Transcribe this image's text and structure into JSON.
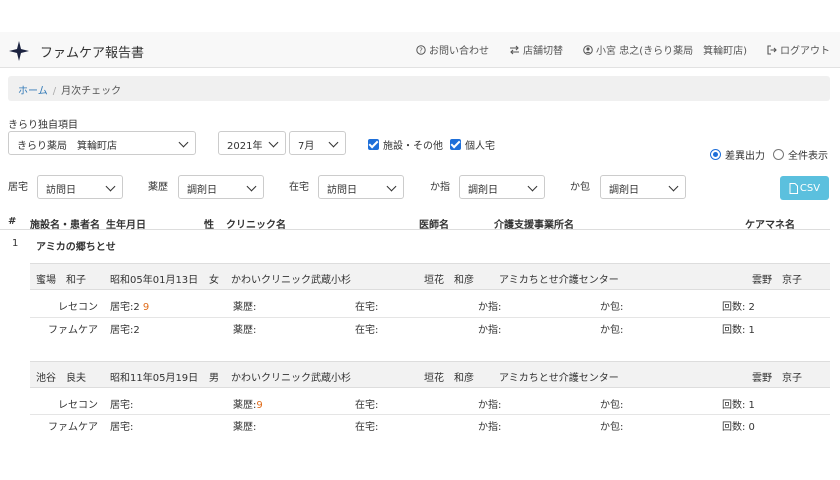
{
  "app": {
    "title": "ファムケア報告書"
  },
  "nav": {
    "contact": "お問い合わせ",
    "switch_store": "店舗切替",
    "user": "小宮 忠之(きらり薬局　箕輪町店)",
    "logout": "ログアウト"
  },
  "breadcrumb": {
    "home": "ホーム",
    "separator": "/",
    "current": "月次チェック"
  },
  "filters": {
    "store_label": "きらり独自項目",
    "store_value": "きらり薬局　箕輪町店",
    "year_value": "2021年",
    "month_value": "7月",
    "check_facility": "施設・その他",
    "check_individual": "個人宅",
    "radio_diff": "差異出力",
    "radio_all": "全件表示",
    "home_label": "居宅",
    "home_value": "訪問日",
    "drug_label": "薬歴",
    "drug_value": "調剤日",
    "zaitaku_label": "在宅",
    "zaitaku_value": "訪問日",
    "kashi_label": "か指",
    "kashi_value": "調剤日",
    "kahou_label": "か包",
    "kahou_value": "調剤日",
    "csv_button": "CSV"
  },
  "table": {
    "headers": {
      "num": "#",
      "facility": "施設名・患者名",
      "birth": "生年月日",
      "sex": "性",
      "clinic": "クリニック名",
      "doctor": "医師名",
      "care": "介護支援事業所名",
      "manager": "ケアマネ名"
    },
    "group": {
      "num": "1",
      "name": "アミカの郷ちとせ"
    },
    "patients": [
      {
        "name": "蜜場　和子",
        "birth": "昭和05年01月13日",
        "sex": "女",
        "clinic": "かわいクリニック武蔵小杉",
        "doctor": "垣花　和彦",
        "care": "アミカちとせ介護センター",
        "manager": "雲野　京子",
        "rows": [
          {
            "source": "レセコン",
            "home": "居宅:2",
            "home_diff": "9",
            "drug": "薬歴:",
            "drug_diff": "",
            "zaitaku": "在宅:",
            "kashi": "か指:",
            "kahou": "か包:",
            "count": "回数: 2"
          },
          {
            "source": "ファムケア",
            "home": "居宅:2",
            "home_diff": "",
            "drug": "薬歴:",
            "drug_diff": "",
            "zaitaku": "在宅:",
            "kashi": "か指:",
            "kahou": "か包:",
            "count": "回数: 1"
          }
        ]
      },
      {
        "name": "池谷　良夫",
        "birth": "昭和11年05月19日",
        "sex": "男",
        "clinic": "かわいクリニック武蔵小杉",
        "doctor": "垣花　和彦",
        "care": "アミカちとせ介護センター",
        "manager": "雲野　京子",
        "rows": [
          {
            "source": "レセコン",
            "home": "居宅:",
            "home_diff": "",
            "drug": "薬歴:",
            "drug_diff": "9",
            "zaitaku": "在宅:",
            "kashi": "か指:",
            "kahou": "か包:",
            "count": "回数: 1"
          },
          {
            "source": "ファムケア",
            "home": "居宅:",
            "home_diff": "",
            "drug": "薬歴:",
            "drug_diff": "",
            "zaitaku": "在宅:",
            "kashi": "か指:",
            "kahou": "か包:",
            "count": "回数: 0"
          }
        ]
      }
    ]
  }
}
